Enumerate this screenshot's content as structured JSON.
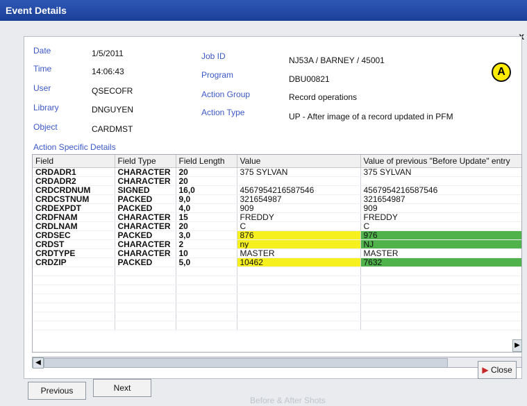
{
  "window": {
    "title": "Event Details",
    "close_glyph": "x"
  },
  "details": {
    "date_label": "Date",
    "date": "1/5/2011",
    "time_label": "Time",
    "time": "14:06:43",
    "user_label": "User",
    "user": "QSECOFR",
    "library_label": "Library",
    "library": "DNGUYEN",
    "object_label": "Object",
    "object": "CARDMST",
    "jobid_label": "Job ID",
    "jobid": "NJ53A / BARNEY / 45001",
    "program_label": "Program",
    "program": "DBU00821",
    "actiongroup_label": "Action Group",
    "actiongroup": "Record operations",
    "actiontype_label": "Action Type",
    "actiontype": "UP - After image of a record updated in PFM",
    "badge": "A"
  },
  "section_label": "Action Specific Details",
  "table": {
    "headers": [
      "Field",
      "Field Type",
      "Field Length",
      "Value",
      "Value of previous \"Before Update\" entry"
    ],
    "rows": [
      {
        "field": "CRDADR1",
        "type": "CHARACTER",
        "len": "20",
        "value": "375 SYLVAN",
        "prev": "375 SYLVAN"
      },
      {
        "field": "CRDADR2",
        "type": "CHARACTER",
        "len": "20",
        "value": "",
        "prev": ""
      },
      {
        "field": "CRDCRDNUM",
        "type": "SIGNED",
        "len": "16,0",
        "value": "4567954216587546",
        "prev": "4567954216587546"
      },
      {
        "field": "CRDCSTNUM",
        "type": "PACKED",
        "len": "9,0",
        "value": "321654987",
        "prev": "321654987"
      },
      {
        "field": "CRDEXPDT",
        "type": "PACKED",
        "len": "4,0",
        "value": "909",
        "prev": "909"
      },
      {
        "field": "CRDFNAM",
        "type": "CHARACTER",
        "len": "15",
        "value": "FREDDY",
        "prev": "FREDDY"
      },
      {
        "field": "CRDLNAM",
        "type": "CHARACTER",
        "len": "20",
        "value": "C",
        "prev": "C"
      },
      {
        "field": "CRDSEC",
        "type": "PACKED",
        "len": "3,0",
        "value": "876",
        "prev": "976"
      },
      {
        "field": "CRDST",
        "type": "CHARACTER",
        "len": "2",
        "value": "ny",
        "prev": "NJ"
      },
      {
        "field": "CRDTYPE",
        "type": "CHARACTER",
        "len": "10",
        "value": "MASTER",
        "prev": "MASTER"
      },
      {
        "field": "CRDZIP",
        "type": "PACKED",
        "len": "5,0",
        "value": "10462",
        "prev": "7632"
      }
    ],
    "highlight_colors": {
      "changed_value": "#f6f01f",
      "previous_value": "#4fb24a"
    }
  },
  "buttons": {
    "previous": "Previous",
    "next": "Next",
    "close": "Close"
  },
  "footer": "Before & After Shots"
}
